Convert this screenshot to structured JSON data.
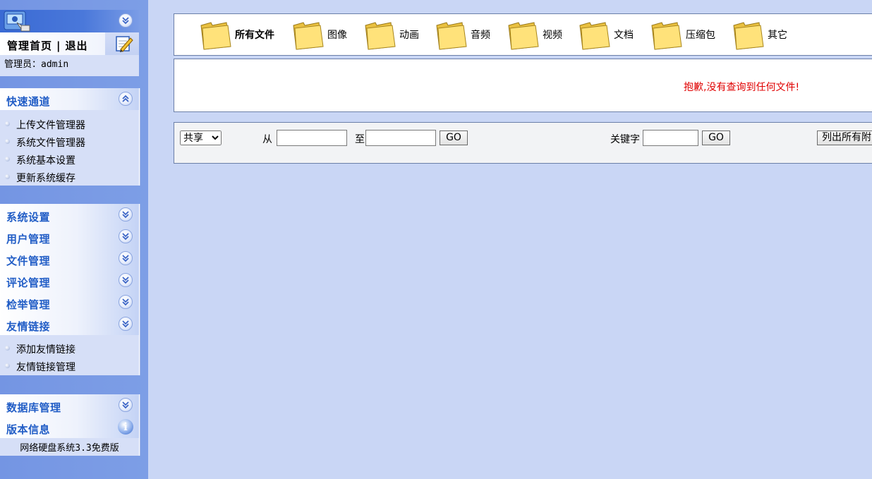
{
  "sidebar": {
    "top_menu": {
      "home": "管理首页",
      "separator": "|",
      "logout": "退出"
    },
    "admin_label": "管理员：",
    "admin_name": "admin",
    "quick_panel": {
      "title": "快速通道",
      "items": [
        "上传文件管理器",
        "系统文件管理器",
        "系统基本设置",
        "更新系统缓存"
      ]
    },
    "sections": [
      "系统设置",
      "用户管理",
      "文件管理",
      "评论管理",
      "检举管理"
    ],
    "links_panel": {
      "title": "友情链接",
      "items": [
        "添加友情链接",
        "友情链接管理"
      ]
    },
    "db_title": "数据库管理",
    "version_title": "版本信息",
    "version_text": "网络硬盘系统3.3免费版",
    "info_icon_text": "i"
  },
  "file_types": [
    {
      "label": "所有文件",
      "active": true
    },
    {
      "label": "图像",
      "active": false
    },
    {
      "label": "动画",
      "active": false
    },
    {
      "label": "音频",
      "active": false
    },
    {
      "label": "视频",
      "active": false
    },
    {
      "label": "文档",
      "active": false
    },
    {
      "label": "压缩包",
      "active": false
    },
    {
      "label": "其它",
      "active": false
    }
  ],
  "result": {
    "message": "抱歉,没有查询到任何文件!"
  },
  "filter": {
    "share_selected": "共享",
    "from_label": "从",
    "to_label": "至",
    "go_label": "GO",
    "keyword_label": "关键字",
    "list_all_label": "列出所有附"
  },
  "colors": {
    "page_bg": "#c9d6f5",
    "sidebar_bg": "#7d9ee6",
    "panel_title": "#215dc6",
    "error_text": "#e00000"
  }
}
